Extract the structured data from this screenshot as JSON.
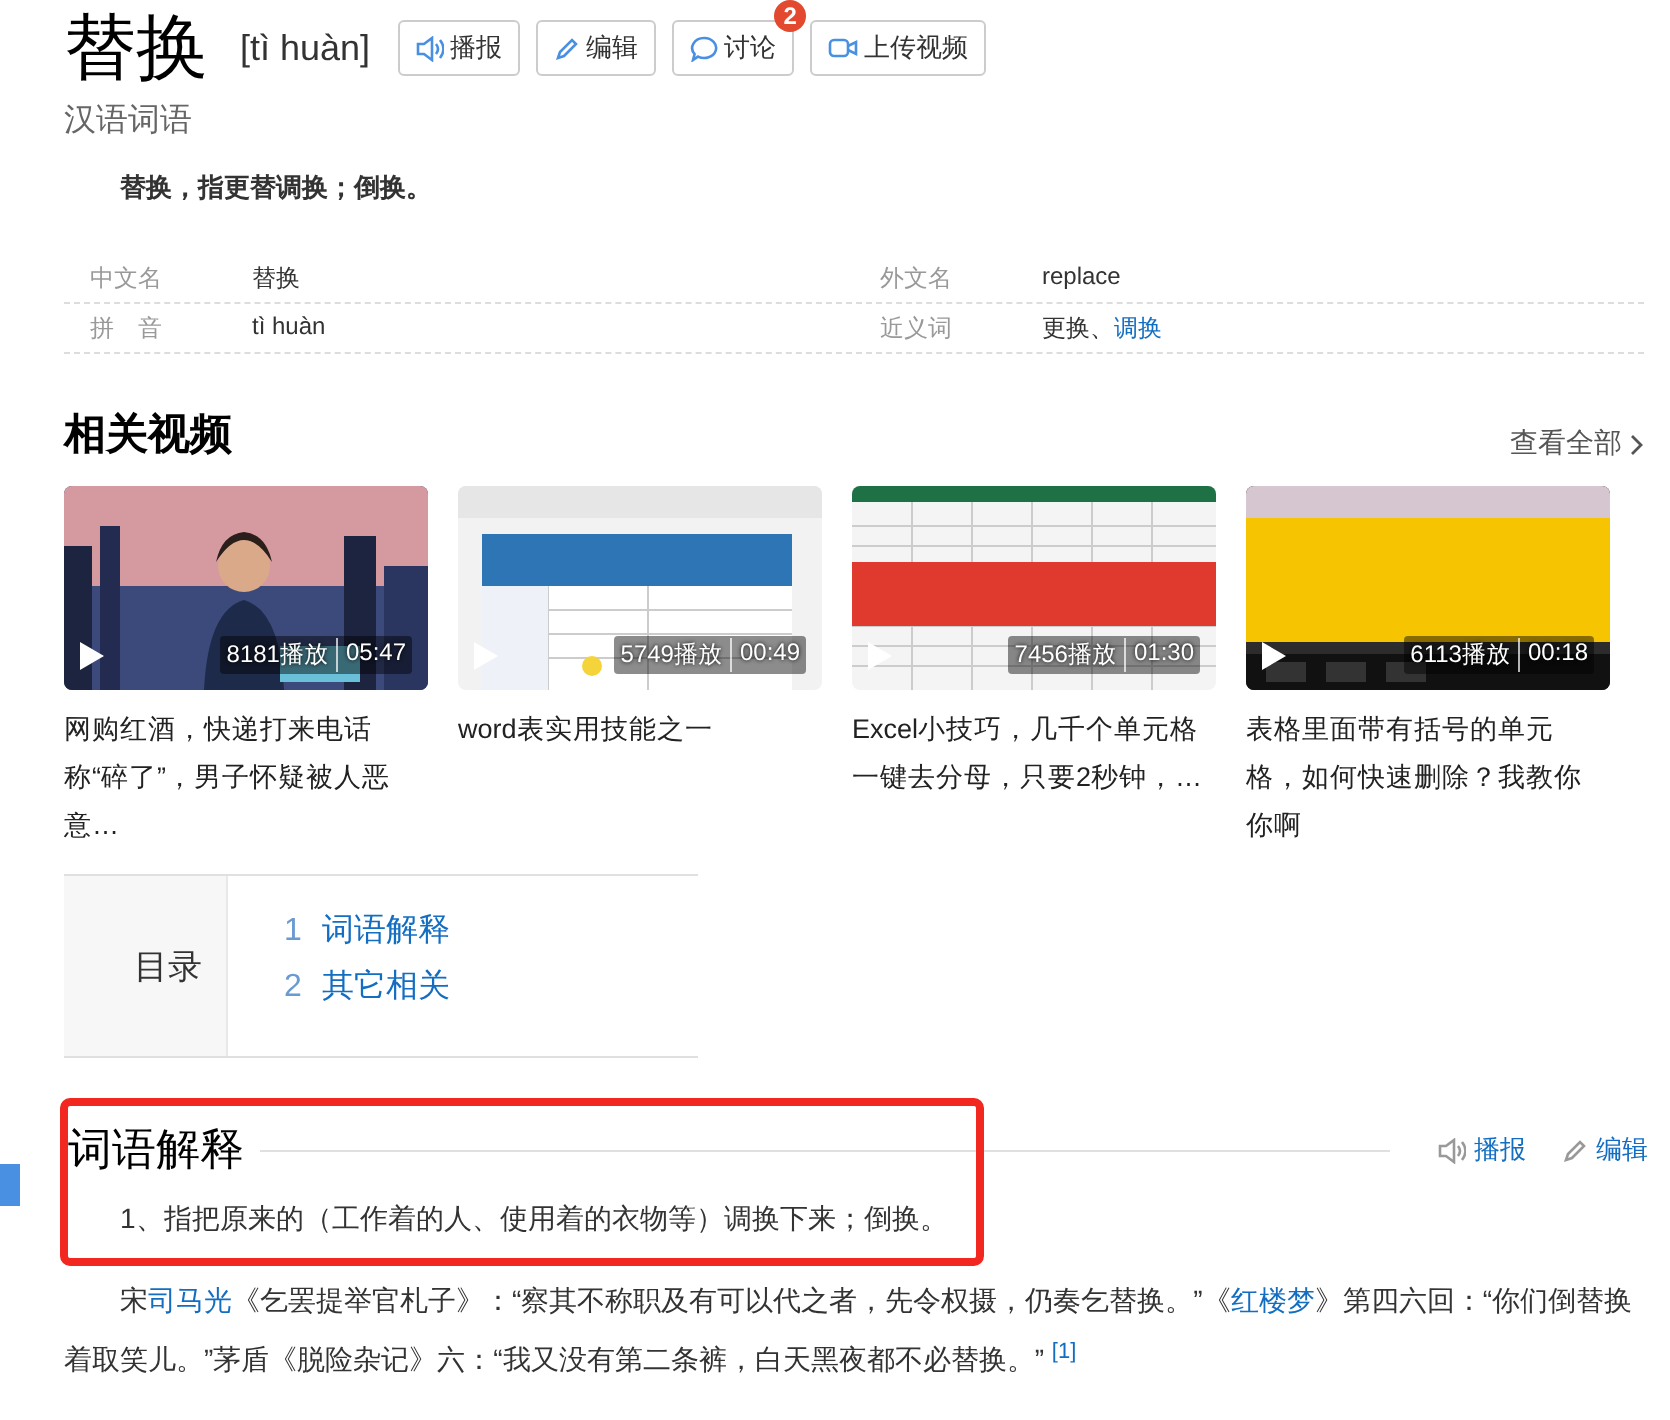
{
  "header": {
    "title": "替换",
    "pinyin": "[tì huàn]",
    "subtitle": "汉语词语",
    "actions": [
      {
        "kind": "speak",
        "label": "播报"
      },
      {
        "kind": "edit",
        "label": "编辑"
      },
      {
        "kind": "discuss",
        "label": "讨论",
        "badge": "2"
      },
      {
        "kind": "video",
        "label": "上传视频"
      }
    ]
  },
  "summary": "替换，指更替调换；倒换。",
  "basic_info": [
    [
      {
        "name": "中文名",
        "value": [
          {
            "text": "替换",
            "link": false
          }
        ]
      },
      {
        "name": "外文名",
        "value": [
          {
            "text": "replace",
            "link": false
          }
        ]
      }
    ],
    [
      {
        "name": "拼　音",
        "value": [
          {
            "text": "tì huàn",
            "link": false
          }
        ]
      },
      {
        "name": "近义词",
        "value": [
          {
            "text": "更换、",
            "link": false
          },
          {
            "text": "调换",
            "link": true
          }
        ]
      }
    ]
  ],
  "videos": {
    "title": "相关视频",
    "more": "查看全部",
    "items": [
      {
        "plays": "8181播放",
        "duration": "05:47",
        "caption": "网购红酒，快递打来电话称“碎了”，男子怀疑被人恶意…"
      },
      {
        "plays": "5749播放",
        "duration": "00:49",
        "caption": "word表实用技能之一"
      },
      {
        "plays": "7456播放",
        "duration": "01:30",
        "caption": "Excel小技巧，几千个单元格一键去分母，只要2秒钟，…"
      },
      {
        "plays": "6113播放",
        "duration": "00:18",
        "caption": "表格里面带有括号的单元格，如何快速删除？我教你你啊"
      }
    ]
  },
  "toc": {
    "title": "目录",
    "items": [
      {
        "number": "1",
        "label": "词语解释"
      },
      {
        "number": "2",
        "label": "其它相关"
      }
    ]
  },
  "section": {
    "title": "词语解释",
    "highlighted": true,
    "actions": [
      {
        "kind": "speak",
        "label": "播报"
      },
      {
        "kind": "edit",
        "label": "编辑"
      }
    ],
    "definitions": [
      "1、指把原来的（工作着的人、使用着的衣物等）调换下来；倒换。"
    ],
    "quote": [
      {
        "text": "宋",
        "link": false
      },
      {
        "text": "司马光",
        "link": true
      },
      {
        "text": "《乞罢提举官札子》：“察其不称职及有可以代之者，先令权摄，仍奏乞替换。”《",
        "link": false
      },
      {
        "text": "红楼梦",
        "link": true
      },
      {
        "text": "》第四六回：“你们倒替换着取笑儿。”茅盾《脱险杂记》六：“我又没有第二条裤，白天黑夜都不必替换。”",
        "link": false
      }
    ],
    "footnote": "[1]"
  }
}
